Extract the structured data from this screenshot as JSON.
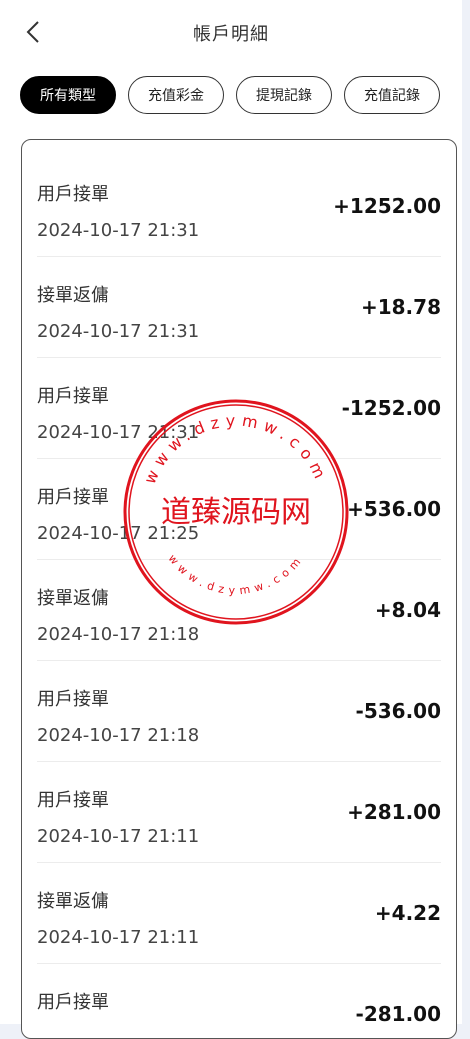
{
  "header": {
    "title": "帳戶明細",
    "back_icon": "chevron-left-icon"
  },
  "filters": [
    {
      "label": "所有類型",
      "active": true
    },
    {
      "label": "充值彩金",
      "active": false
    },
    {
      "label": "提現記錄",
      "active": false
    },
    {
      "label": "充值記錄",
      "active": false
    }
  ],
  "records": [
    {
      "type": "用戶接單",
      "time": "2024-10-17 21:31",
      "amount": "+1252.00"
    },
    {
      "type": "接單返傭",
      "time": "2024-10-17 21:31",
      "amount": "+18.78"
    },
    {
      "type": "用戶接單",
      "time": "2024-10-17 21:31",
      "amount": "-1252.00"
    },
    {
      "type": "用戶接單",
      "time": "2024-10-17 21:25",
      "amount": "+536.00"
    },
    {
      "type": "接單返傭",
      "time": "2024-10-17 21:18",
      "amount": "+8.04"
    },
    {
      "type": "用戶接單",
      "time": "2024-10-17 21:18",
      "amount": "-536.00"
    },
    {
      "type": "用戶接單",
      "time": "2024-10-17 21:11",
      "amount": "+281.00"
    },
    {
      "type": "接單返傭",
      "time": "2024-10-17 21:11",
      "amount": "+4.22"
    },
    {
      "type": "用戶接單",
      "time": "",
      "amount": "-281.00"
    }
  ],
  "watermark": {
    "text": "道臻源码网",
    "url": "www.dzymw.com",
    "color": "#e0141e"
  }
}
